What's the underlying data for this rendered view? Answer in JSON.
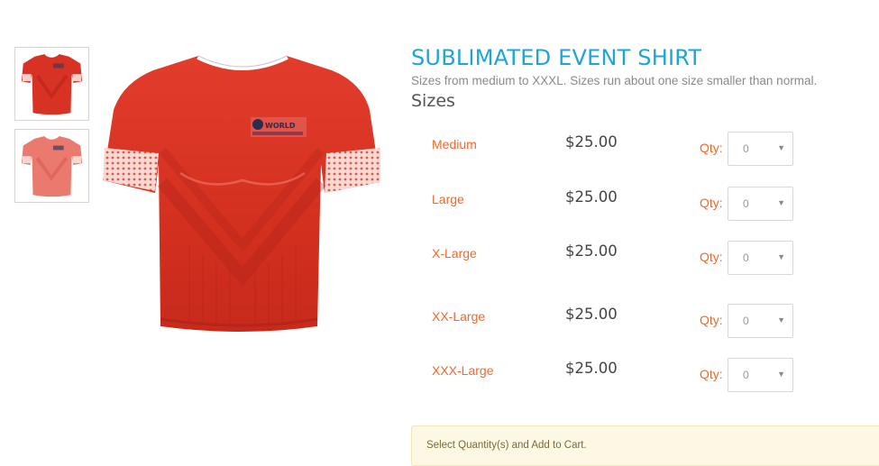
{
  "product": {
    "title": "SUBLIMATED EVENT SHIRT",
    "description": "Sizes from medium to XXXL. Sizes run about one size smaller than normal.",
    "sizes_heading": "Sizes",
    "thumbnails": [
      {
        "icon": "shirt-thumbnail-red"
      },
      {
        "icon": "shirt-thumbnail-pink"
      }
    ],
    "main_image": {
      "icon": "red-event-shirt-image",
      "logo_text": "WORLD"
    },
    "colors": {
      "title": "#1aa6d6",
      "size_label": "#f0682b",
      "shirt": "#e0382b",
      "notice_bg": "#fcf8e3"
    }
  },
  "sizes": [
    {
      "name": "Medium",
      "price": "$25.00",
      "qty_label": "Qty:",
      "qty_value": "0"
    },
    {
      "name": "Large",
      "price": "$25.00",
      "qty_label": "Qty:",
      "qty_value": "0"
    },
    {
      "name": "X-Large",
      "price": "$25.00",
      "qty_label": "Qty:",
      "qty_value": "0"
    },
    {
      "name": "XX-Large",
      "price": "$25.00",
      "qty_label": "Qty:",
      "qty_value": "0"
    },
    {
      "name": "XXX-Large",
      "price": "$25.00",
      "qty_label": "Qty:",
      "qty_value": "0"
    }
  ],
  "notice": {
    "text": "Select Quantity(s) and Add to Cart."
  }
}
